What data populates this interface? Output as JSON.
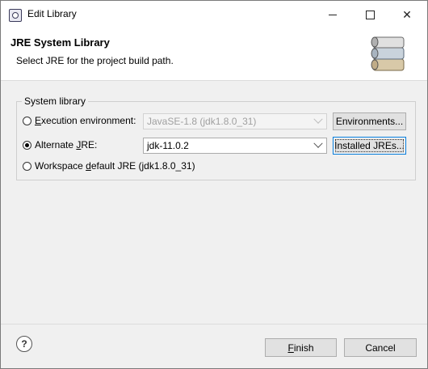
{
  "window": {
    "title": "Edit Library"
  },
  "header": {
    "title": "JRE System Library",
    "description": "Select JRE for the project build path."
  },
  "system_library": {
    "group_label": "System library",
    "execution_environment": {
      "label_prefix": "E",
      "label_rest": "xecution environment:",
      "selected": false,
      "combo_value": "JavaSE-1.8 (jdk1.8.0_31)",
      "combo_enabled": false,
      "button_label": "Environments..."
    },
    "alternate_jre": {
      "label_prefix": "Alternate ",
      "label_underlined": "J",
      "label_rest": "RE:",
      "selected": true,
      "combo_value": "jdk-11.0.2",
      "button_label": "Installed JREs..."
    },
    "workspace_default": {
      "label_prefix": "Workspace ",
      "label_underlined": "d",
      "label_rest": "efault JRE (jdk1.8.0_31)",
      "selected": false
    }
  },
  "footer": {
    "help_symbol": "?",
    "finish_underlined": "F",
    "finish_rest": "inish",
    "cancel_label": "Cancel"
  }
}
